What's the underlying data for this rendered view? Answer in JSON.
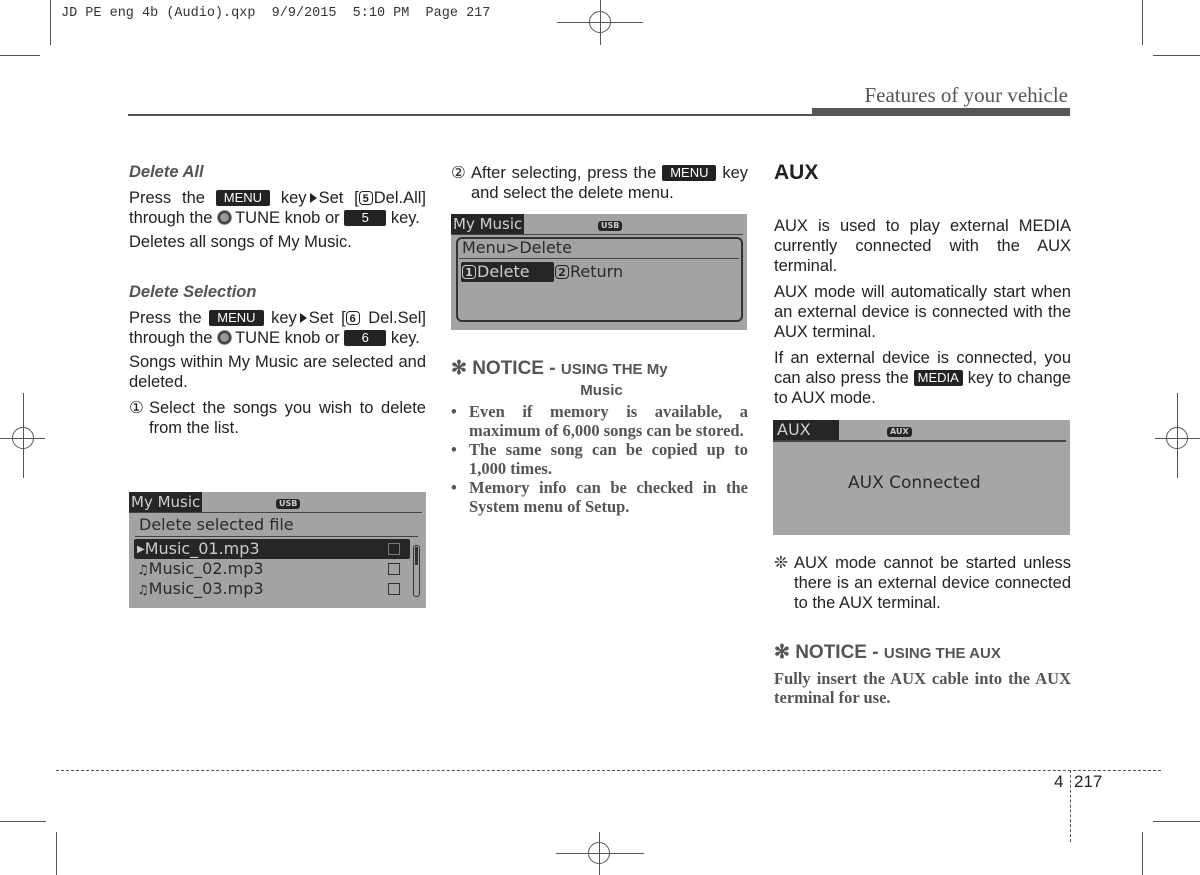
{
  "slug": "JD PE eng 4b (Audio).qxp  9/9/2015  5:10 PM  Page 217",
  "header": {
    "section_title": "Features of your vehicle"
  },
  "footer": {
    "chapter": "4",
    "page": "217"
  },
  "left_column": {
    "delete_all": {
      "heading": "Delete All",
      "line1_a": "Press the",
      "menu_key": "MENU",
      "line1_b": "key",
      "line1_c": "Set [",
      "circ_5": "5",
      "line1_d": "Del.All]",
      "line2_a": "through the",
      "line2_b": "TUNE knob or",
      "key_5": "5",
      "line3": "key.",
      "desc": "Deletes all songs of My Music."
    },
    "delete_selection": {
      "heading": "Delete Selection",
      "line1_a": "Press the",
      "menu_key": "MENU",
      "line1_b": "key",
      "line1_c": "Set [",
      "circ_6": "6",
      "line2_a": "Del.Sel] through the",
      "line2_b": "TUNE knob",
      "line3_a": "or",
      "key_6": "6",
      "line3_b": "key.",
      "desc": "Songs within My Music are selected and deleted.",
      "step1_mark": "①",
      "step1": "Select the songs you wish to delete from the list."
    },
    "screen": {
      "tab": "My Music",
      "badge": "USB",
      "title": "Delete selected file",
      "files": [
        "Music_01.mp3",
        "Music_02.mp3",
        "Music_03.mp3"
      ],
      "selected_index": 0
    }
  },
  "middle_column": {
    "step2_mark": "②",
    "step2_a": "After selecting, press the",
    "menu_key": "MENU",
    "step2_b": "key and select the delete menu.",
    "screen": {
      "tab": "My Music",
      "badge": "USB",
      "title": "Menu>Delete",
      "option1_num": "1",
      "option1": "Delete",
      "option2_num": "2",
      "option2": "Return"
    },
    "notice": {
      "symbol": "✻",
      "label": "NOTICE -",
      "subtitle_a": "USING THE My",
      "subtitle_b": "Music",
      "items": [
        "Even if memory is available, a maximum of 6,000 songs can be stored.",
        "The same song can be copied up to 1,000 times.",
        "Memory info can be checked in the System menu of Setup."
      ]
    }
  },
  "right_column": {
    "heading": "AUX",
    "p1": "AUX is used to play external MEDIA currently connected with the AUX terminal.",
    "p2": "AUX mode will automatically start when an external device is connected with the AUX terminal.",
    "p3_a": "If an external device is connected, you can also press the",
    "media_key": "MEDIA",
    "p3_b": "key to change to AUX mode.",
    "screen": {
      "tab": "AUX",
      "badge": "AUX",
      "message": "AUX Connected"
    },
    "note_symbol": "❊",
    "note": "AUX mode cannot be started unless there is an external device connected to the AUX terminal.",
    "notice": {
      "symbol": "✻",
      "label": "NOTICE -",
      "subtitle": "USING THE AUX",
      "text": "Fully insert the AUX cable into the AUX terminal for use."
    }
  }
}
